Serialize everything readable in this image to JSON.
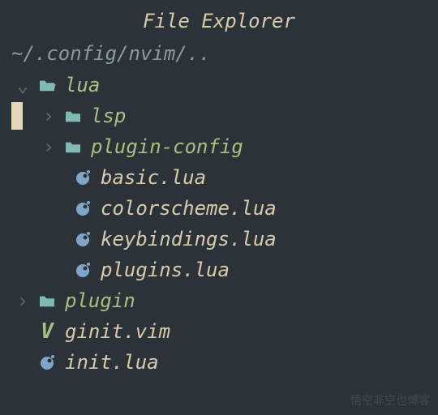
{
  "title": "File Explorer",
  "path": "~/.config/nvim/..",
  "tree": {
    "lua": {
      "label": "lua",
      "expanded": true,
      "children": {
        "lsp": {
          "label": "lsp",
          "expanded": false
        },
        "plugin_config": {
          "label": "plugin-config",
          "expanded": false
        },
        "basic": {
          "label": "basic.lua"
        },
        "colorscheme": {
          "label": "colorscheme.lua"
        },
        "keybindings": {
          "label": "keybindings.lua"
        },
        "plugins": {
          "label": "plugins.lua"
        }
      }
    },
    "plugin": {
      "label": "plugin",
      "expanded": false
    },
    "ginit": {
      "label": "ginit.vim"
    },
    "init": {
      "label": "init.lua"
    }
  },
  "glyphs": {
    "chev_down": "⌄",
    "chev_right": "›"
  },
  "watermark": "悟空非空也博客"
}
